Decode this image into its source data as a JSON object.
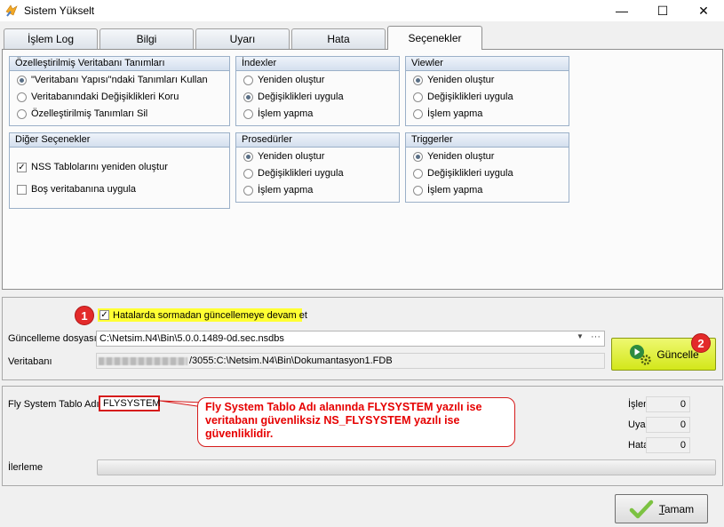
{
  "window": {
    "title": "Sistem Yükselt",
    "minimize_label": "—",
    "maximize_label": "☐",
    "close_label": "✕"
  },
  "tabs": [
    "İşlem Log",
    "Bilgi",
    "Uyarı",
    "Hata",
    "Seçenekler"
  ],
  "custom_db": {
    "title": "Özelleştirilmiş Veritabanı Tanımları",
    "options": [
      "\"Veritabanı Yapısı\"ndaki Tanımları Kullan",
      "Veritabanındaki Değişiklikleri Koru",
      "Özelleştirilmiş Tanımları Sil"
    ]
  },
  "indexes": {
    "title": "İndexler",
    "options": [
      "Yeniden oluştur",
      "Değişiklikleri uygula",
      "İşlem yapma"
    ]
  },
  "views": {
    "title": "Viewler",
    "options": [
      "Yeniden oluştur",
      "Değişiklikleri uygula",
      "İşlem yapma"
    ]
  },
  "other": {
    "title": "Diğer Seçenekler",
    "options": [
      "NSS Tablolarını yeniden oluştur",
      "Boş veritabanına uygula"
    ]
  },
  "procedures": {
    "title": "Prosedürler",
    "options": [
      "Yeniden oluştur",
      "Değişiklikleri uygula",
      "İşlem yapma"
    ]
  },
  "triggers": {
    "title": "Triggerler",
    "options": [
      "Yeniden oluştur",
      "Değişiklikleri uygula",
      "İşlem yapma"
    ]
  },
  "update": {
    "continue_label": "Hatalarda sormadan güncellemeye devam et",
    "file_label": "Güncelleme dosyası",
    "file_value": "C:\\Netsim.N4\\Bin\\5.0.0.1489-0d.sec.nsdbs",
    "db_label": "Veritabanı",
    "db_value": "/3055:C:\\Netsim.N4\\Bin\\Dokumantasyon1.FDB",
    "update_button": "Güncelle",
    "badge1": "1",
    "badge2": "2"
  },
  "status": {
    "fly_label": "Fly System Tablo Adı",
    "fly_value": "FLYSYSTEM",
    "callout": "Fly System Tablo Adı alanında FLYSYSTEM yazılı ise veritabanı güvenliksiz NS_FLYSYSTEM yazılı ise güvenliklidir.",
    "islem_label": "İşlem",
    "islem_value": "0",
    "uyari_label": "Uyarı",
    "uyari_value": "0",
    "hata_label": "Hata",
    "hata_value": "0",
    "progress_label": "İlerleme",
    "progress": 0
  },
  "footer": {
    "ok_prefix": "T",
    "ok_rest": "amam"
  },
  "colors": {
    "accent_yellow": "#ffff33",
    "update_button_bg": "#dcf020",
    "callout_red": "#e60000",
    "badge_red": "#e32a2a"
  }
}
